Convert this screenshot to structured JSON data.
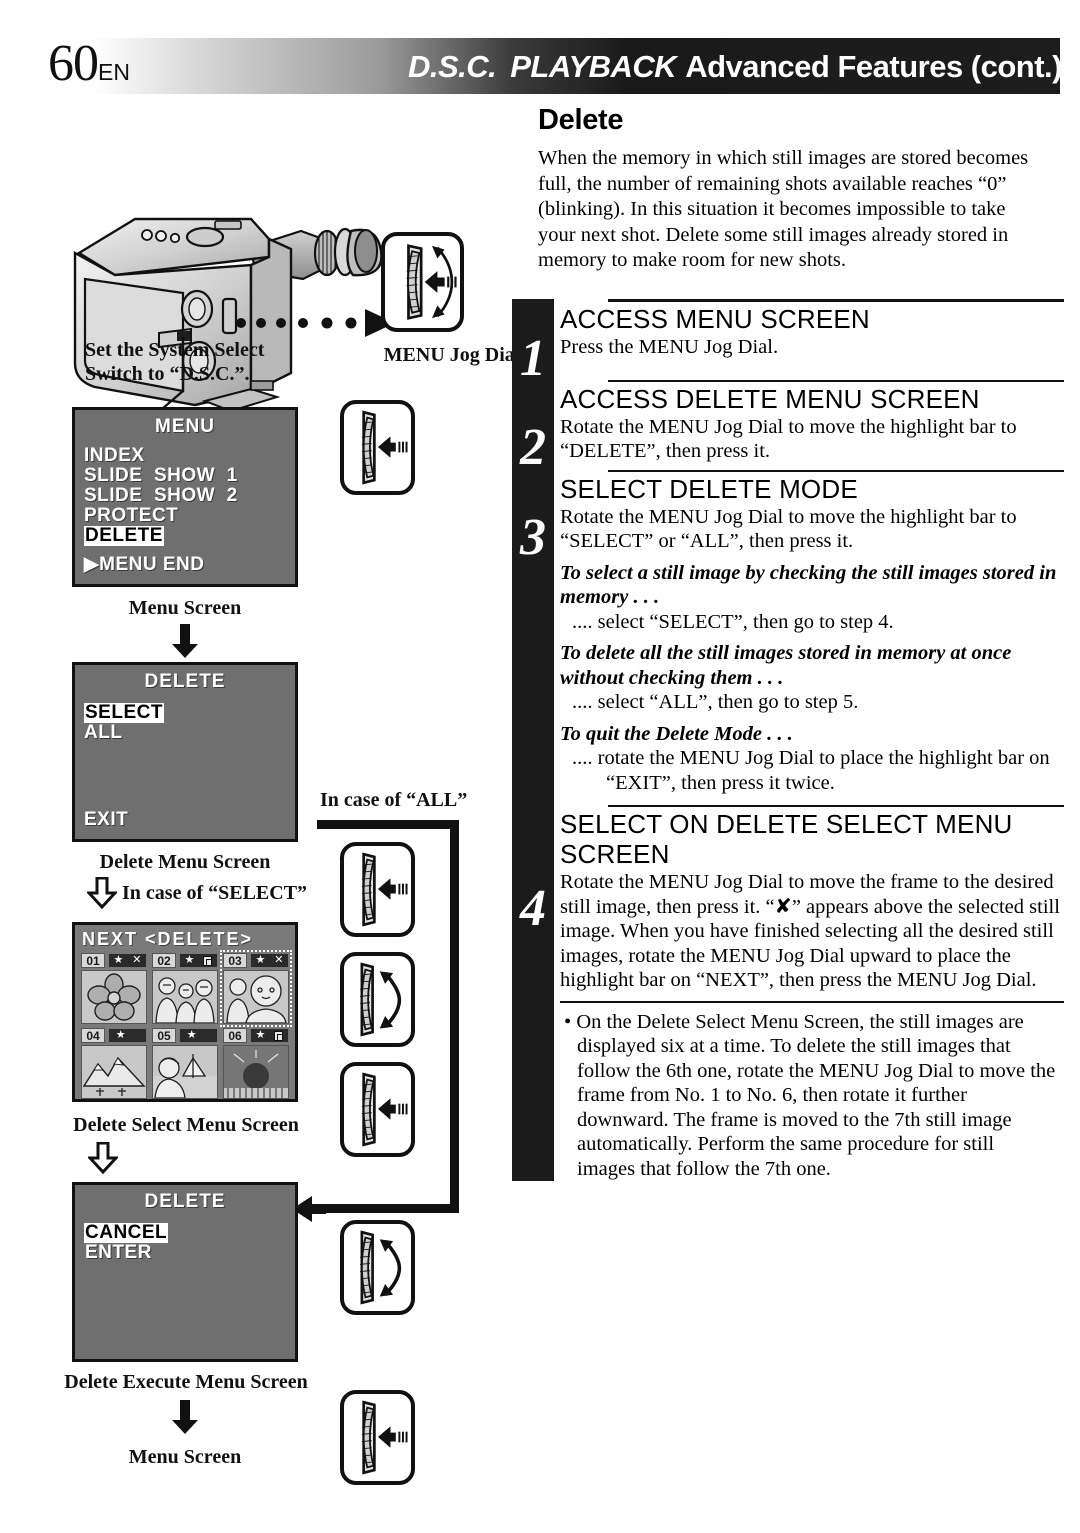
{
  "header": {
    "page_number": "60",
    "page_lang": "EN",
    "title_dsc": "D.S.C.",
    "title_playback": "PLAYBACK",
    "title_rest": "Advanced Features (cont.)"
  },
  "main": {
    "heading": "Delete",
    "intro": "When the memory in which still images are stored becomes full, the number of remaining shots available reaches “0” (blinking). In this situation it becomes impossible to take your next shot. Delete some still images already stored in memory to make room for new shots."
  },
  "steps": [
    {
      "number": "1",
      "title": "ACCESS MENU SCREEN",
      "body": "Press the MENU Jog Dial."
    },
    {
      "number": "2",
      "title": "ACCESS DELETE MENU SCREEN",
      "body": "Rotate the MENU Jog Dial to move the highlight bar to “DELETE”, then press it."
    },
    {
      "number": "3",
      "title": "SELECT DELETE MODE",
      "body": "Rotate the MENU Jog Dial to move the highlight bar to “SELECT” or “ALL”, then press it.",
      "notes": [
        {
          "head": "To select a still image by checking the still images stored in memory . . .",
          "body": ".... select “SELECT”, then go to step 4."
        },
        {
          "head": "To delete all the still images stored in memory at once without checking them . . .",
          "body": ".... select “ALL”, then go to step 5."
        },
        {
          "head": "To quit the Delete Mode . . .",
          "body": ".... rotate the MENU Jog Dial to place the highlight bar on “EXIT”, then press it twice."
        }
      ]
    },
    {
      "number": "4",
      "title": "SELECT ON DELETE SELECT MENU SCREEN",
      "body": "Rotate the MENU Jog Dial to move the frame to the desired still image, then press it. “✘” appears above the selected still image. When you have finished selecting all the desired still images, rotate the MENU Jog Dial upward to place the highlight bar on “NEXT”, then press the MENU Jog Dial."
    }
  ],
  "bullet_note": "On the Delete Select Menu Screen, the still images are displayed six at a time. To delete the still images that follow the 6th one, rotate the MENU Jog Dial to move the frame from No. 1 to No. 6, then rotate it further downward. The frame is moved to the 7th still image automatically. Perform the same procedure for still images that follow the 7th one.",
  "left": {
    "camera_caption": "Set the System Select\nSwitch to “D.S.C.”.",
    "jog_dial_caption": "MENU Jog Dial",
    "caption_menu_screen_top": "Menu Screen",
    "caption_delete_menu": "Delete Menu Screen",
    "caption_in_case_select": "In case of “SELECT”",
    "caption_in_case_all": "In case of “ALL”",
    "caption_delete_select": "Delete Select Menu Screen",
    "caption_delete_execute": "Delete Execute Menu Screen",
    "caption_menu_screen_bottom": "Menu Screen"
  },
  "lcd_menu": {
    "title": "MENU",
    "items": [
      "INDEX",
      "SLIDE  SHOW  1",
      "SLIDE  SHOW  2",
      "PROTECT",
      "DELETE"
    ],
    "highlighted": "DELETE",
    "bottom": "▶MENU  END"
  },
  "lcd_delete": {
    "title": "DELETE",
    "items": [
      "SELECT",
      "ALL"
    ],
    "highlighted": "SELECT",
    "bottom": "EXIT"
  },
  "lcd_execute": {
    "title": "DELETE",
    "items": [
      "CANCEL",
      "ENTER"
    ],
    "highlighted": "CANCEL",
    "bottom": ""
  },
  "grid_screen": {
    "header": "NEXT  <DELETE>",
    "selected_index": 2,
    "thumbs": [
      {
        "num": "01",
        "star": "★",
        "mark": "✕",
        "lock": false,
        "subject": "flower"
      },
      {
        "num": "02",
        "star": "★",
        "mark": "",
        "lock": true,
        "subject": "group"
      },
      {
        "num": "03",
        "star": "★",
        "mark": "✕",
        "lock": false,
        "subject": "portrait"
      },
      {
        "num": "04",
        "star": "★",
        "mark": "",
        "lock": false,
        "subject": "mountain"
      },
      {
        "num": "05",
        "star": "★",
        "mark": "",
        "lock": false,
        "subject": "beach"
      },
      {
        "num": "06",
        "star": "★",
        "mark": "",
        "lock": true,
        "subject": "sunset"
      }
    ]
  },
  "icons": {
    "jog_press": "jog-dial-press-icon",
    "jog_rotate": "jog-dial-rotate-icon"
  },
  "colors": {
    "lcd_background": "#6f6f6f",
    "ink": "#111111",
    "highlight_bg": "#ffffff"
  }
}
